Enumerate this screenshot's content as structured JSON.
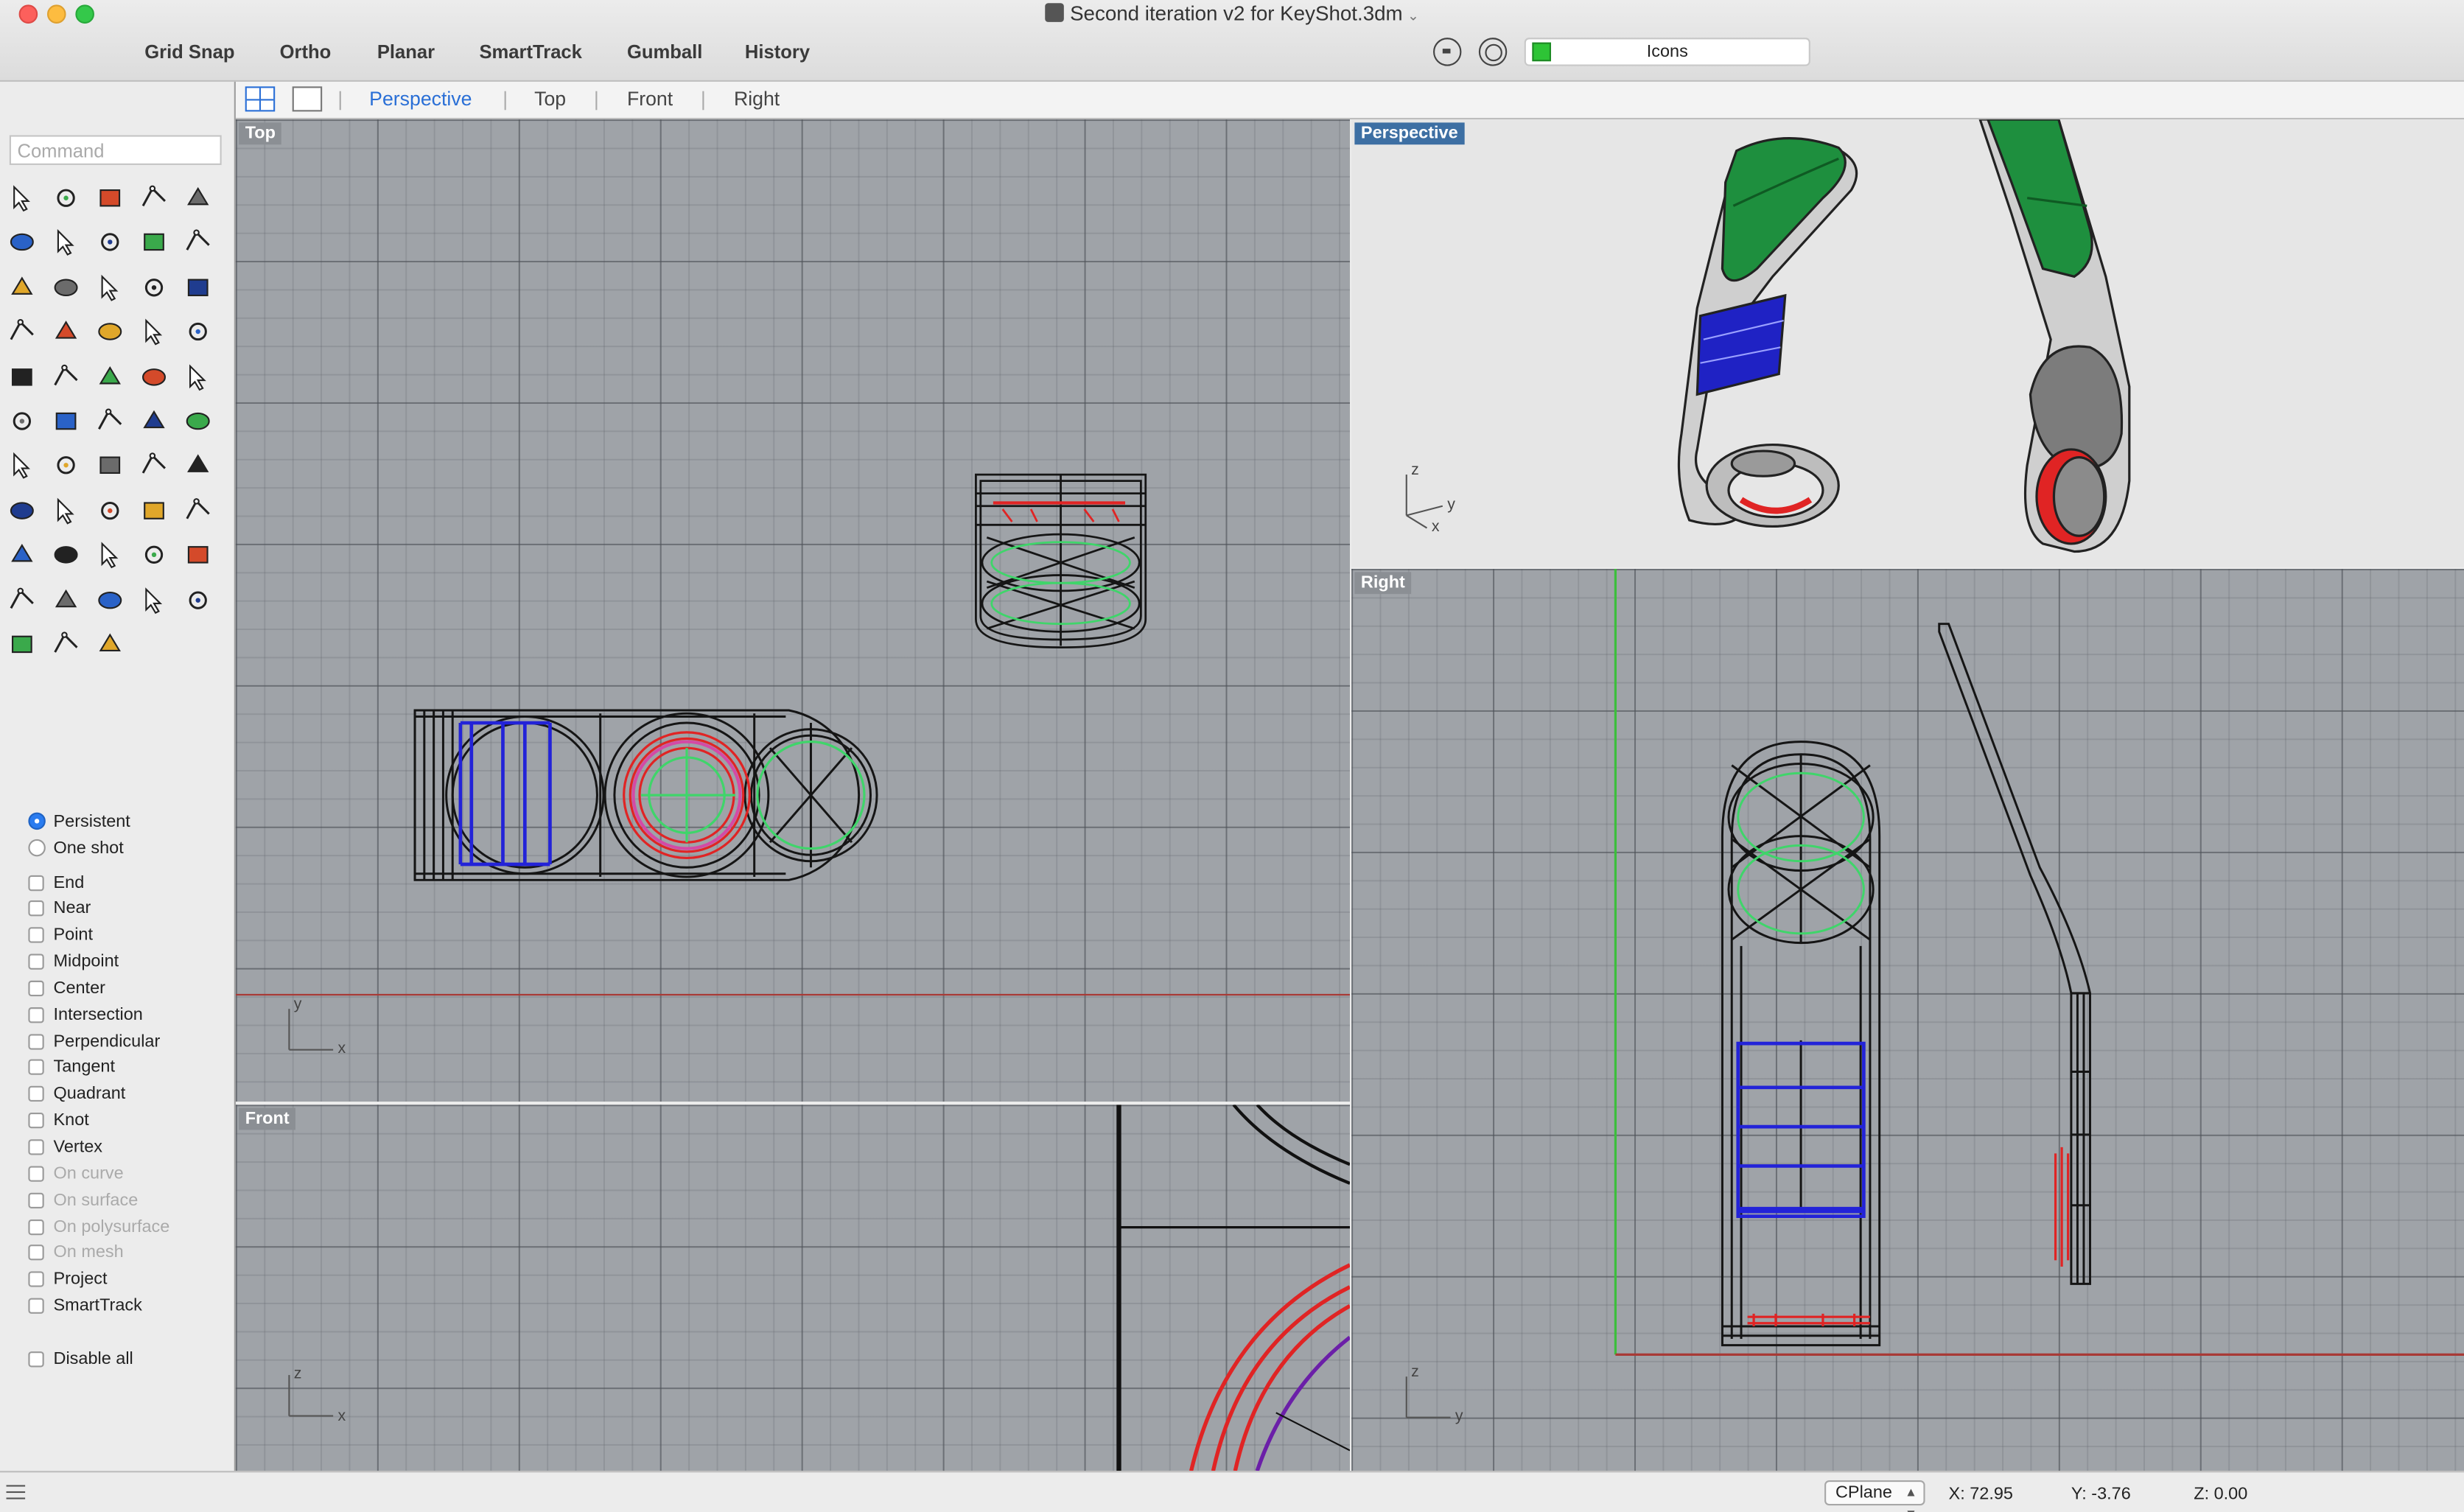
{
  "window": {
    "title": "Second iteration v2 for KeyShot.3dm"
  },
  "toolbar": {
    "buttons": [
      "Grid Snap",
      "Ortho",
      "Planar",
      "SmartTrack",
      "Gumball",
      "History"
    ],
    "layer": {
      "name": "Icons",
      "color": "#2ec436"
    }
  },
  "tabs": {
    "items": [
      "Perspective",
      "Top",
      "Front",
      "Right"
    ],
    "active": "Perspective"
  },
  "command": {
    "placeholder": "Command"
  },
  "tools": [
    "select-arrow",
    "point",
    "polyline",
    "curve",
    "circle",
    "ellipse",
    "polygon",
    "rectangle",
    "arc-3pt",
    "fillet-curve",
    "surface-from-points",
    "extrude-surface",
    "box-solid",
    "sphere-solid",
    "cylinder-solid",
    "surface-network",
    "patch",
    "edge-tools",
    "split",
    "trim",
    "boolean-union",
    "boolean-group",
    "blend-curve",
    "offset-curve",
    "text",
    "transform",
    "array",
    "flow",
    "solid-edit",
    "extrude-face",
    "grid-array",
    "dimension",
    "orient",
    "check",
    "mesh",
    "lasso",
    "zoom",
    "zoom-window",
    "zoom-extents",
    "magnifier",
    "rotate-view",
    "car",
    "render-grid",
    "gumball-tools",
    "light",
    "lock",
    "layer-book",
    "color-wheel",
    "environment",
    "render-sphere",
    "material-ball",
    "pen-draw",
    "tree-dimensions"
  ],
  "osnap": {
    "mode": [
      {
        "label": "Persistent",
        "selected": true
      },
      {
        "label": "One shot",
        "selected": false
      }
    ],
    "items": [
      {
        "label": "End",
        "enabled": true
      },
      {
        "label": "Near",
        "enabled": true
      },
      {
        "label": "Point",
        "enabled": true
      },
      {
        "label": "Midpoint",
        "enabled": true
      },
      {
        "label": "Center",
        "enabled": true
      },
      {
        "label": "Intersection",
        "enabled": true
      },
      {
        "label": "Perpendicular",
        "enabled": true
      },
      {
        "label": "Tangent",
        "enabled": true
      },
      {
        "label": "Quadrant",
        "enabled": true
      },
      {
        "label": "Knot",
        "enabled": true
      },
      {
        "label": "Vertex",
        "enabled": true
      },
      {
        "label": "On curve",
        "enabled": false
      },
      {
        "label": "On surface",
        "enabled": false
      },
      {
        "label": "On polysurface",
        "enabled": false
      },
      {
        "label": "On mesh",
        "enabled": false
      },
      {
        "label": "Project",
        "enabled": true
      },
      {
        "label": "SmartTrack",
        "enabled": true
      }
    ],
    "disable_all": "Disable all"
  },
  "viewports": {
    "top": {
      "label": "Top",
      "axis_a": "y",
      "axis_b": "x"
    },
    "perspective": {
      "label": "Perspective",
      "axis_z": "z",
      "axis_y": "y",
      "axis_x": "x"
    },
    "front": {
      "label": "Front",
      "axis_a": "z",
      "axis_b": "x"
    },
    "right": {
      "label": "Right",
      "axis_a": "z",
      "axis_b": "y"
    }
  },
  "status": {
    "cplane": "CPlane",
    "x": "X: 72.95",
    "y": "Y: -3.76",
    "z": "Z: 0.00"
  }
}
